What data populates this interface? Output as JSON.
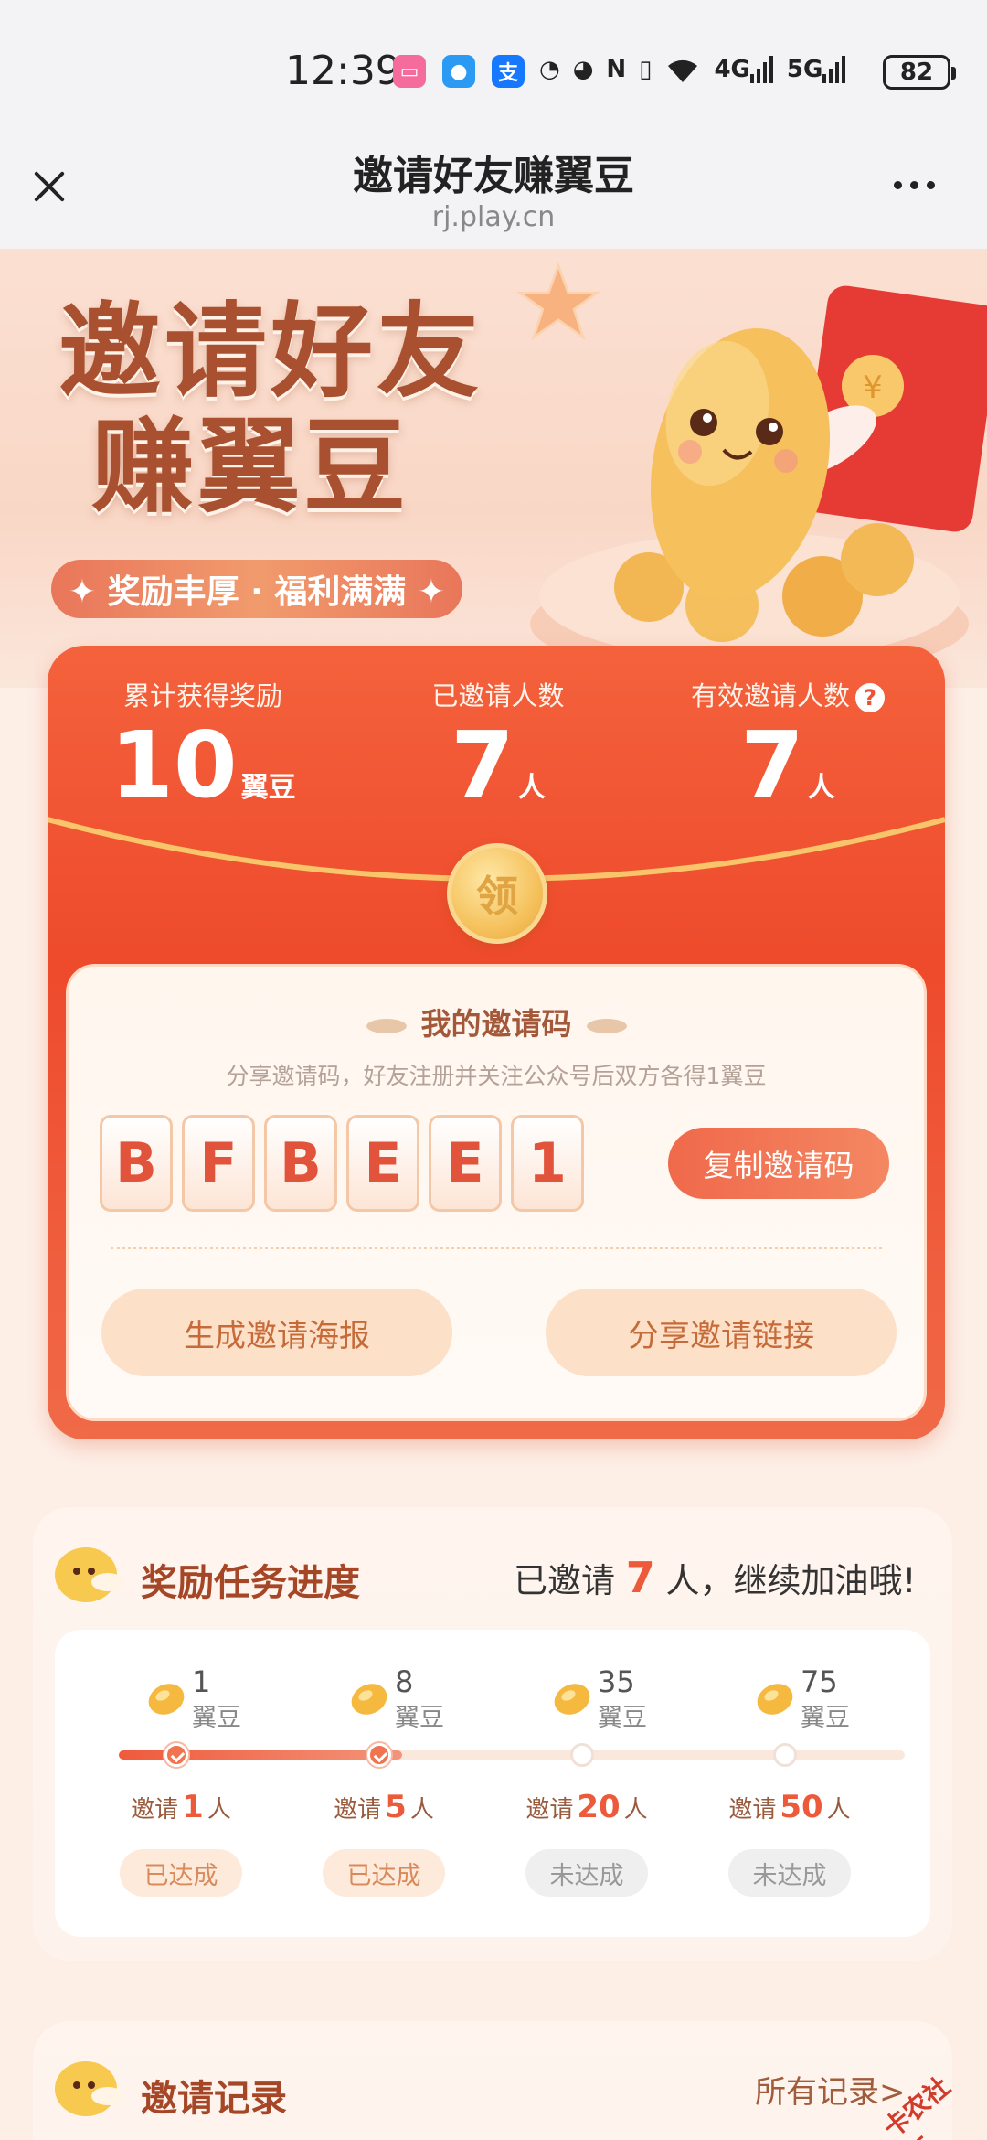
{
  "status_bar": {
    "time": "12:39",
    "battery": "82",
    "network_1": "4G",
    "network_2": "5G",
    "app_icons": [
      "bilibili-icon",
      "message-icon",
      "alipay-icon"
    ]
  },
  "titlebar": {
    "title": "邀请好友赚翼豆",
    "url": "rj.play.cn"
  },
  "hero": {
    "title_line1": "邀请好友",
    "title_line2": "赚翼豆",
    "tagline": "✦ 奖励丰厚 · 福利满满 ✦"
  },
  "stats": {
    "total_reward_label": "累计获得奖励",
    "total_reward_value": "10",
    "total_reward_unit": "翼豆",
    "invited_label": "已邀请人数",
    "invited_value": "7",
    "invited_unit": "人",
    "valid_label": "有效邀请人数",
    "valid_value": "7",
    "valid_unit": "人",
    "coin_label": "领"
  },
  "invite_code": {
    "title": "我的邀请码",
    "subtitle": "分享邀请码，好友注册并关注公众号后双方各得1翼豆",
    "chars": [
      "B",
      "F",
      "B",
      "E",
      "E",
      "1"
    ],
    "copy_button": "复制邀请码",
    "poster_button": "生成邀请海报",
    "share_button": "分享邀请链接"
  },
  "progress": {
    "title": "奖励任务进度",
    "status_prefix": "已邀请",
    "status_count": "7",
    "status_suffix": "人，继续加油哦!",
    "progress_fraction": 0.36,
    "tiers": [
      {
        "amount": "1",
        "unit": "翼豆",
        "need_prefix": "邀请",
        "need": "1",
        "need_unit": "人",
        "status": "已达成",
        "done": true
      },
      {
        "amount": "8",
        "unit": "翼豆",
        "need_prefix": "邀请",
        "need": "5",
        "need_unit": "人",
        "status": "已达成",
        "done": true
      },
      {
        "amount": "35",
        "unit": "翼豆",
        "need_prefix": "邀请",
        "need": "20",
        "need_unit": "人",
        "status": "未达成",
        "done": false
      },
      {
        "amount": "75",
        "unit": "翼豆",
        "need_prefix": "邀请",
        "need": "50",
        "need_unit": "人",
        "status": "未达成",
        "done": false
      }
    ]
  },
  "records": {
    "title": "邀请记录",
    "all_link": "所有记录>"
  },
  "watermark": "卡农社区",
  "colors": {
    "accent": "#ee4a2c",
    "brand_brown": "#a54726",
    "page_bg": "#fdeee6"
  }
}
